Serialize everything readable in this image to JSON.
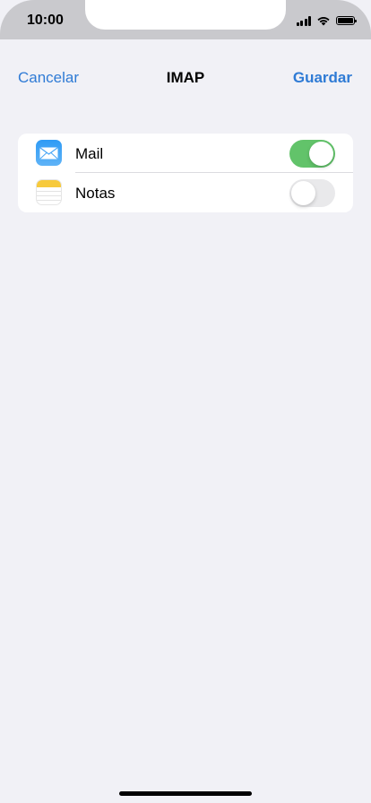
{
  "status_bar": {
    "time": "10:00",
    "icons": [
      "signal-icon",
      "wifi-icon",
      "battery-icon"
    ]
  },
  "nav": {
    "cancel_label": "Cancelar",
    "title": "IMAP",
    "save_label": "Guardar"
  },
  "settings": [
    {
      "label": "Mail",
      "icon": "mail-icon",
      "enabled": true
    },
    {
      "label": "Notas",
      "icon": "notes-icon",
      "enabled": false
    }
  ],
  "colors": {
    "accent": "#2f7bd5",
    "toggle_on": "#62c36a",
    "toggle_off": "#e9e9eb",
    "background": "#f1f1f6"
  }
}
